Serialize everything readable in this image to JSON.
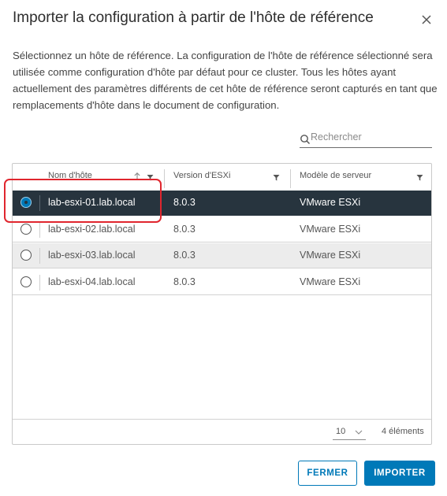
{
  "dialog": {
    "title": "Importer la configuration à partir de l'hôte de référence",
    "description": "Sélectionnez un hôte de référence. La configuration de l'hôte de référence sélectionné sera utilisée comme configuration d'hôte par défaut pour ce cluster. Tous les hôtes ayant actuellement des paramètres différents de cet hôte de référence seront capturés en tant que remplacements d'hôte dans le document de configuration."
  },
  "search": {
    "placeholder": "Rechercher",
    "icon": "search-icon"
  },
  "table": {
    "columns": [
      {
        "label": "Nom d'hôte",
        "sortable": true,
        "filterable": true
      },
      {
        "label": "Version d'ESXi",
        "filterable": true
      },
      {
        "label": "Modèle de serveur",
        "filterable": true
      }
    ],
    "rows": [
      {
        "host": "lab-esxi-01.lab.local",
        "version": "8.0.3",
        "model": "VMware ESXi",
        "selected": true
      },
      {
        "host": "lab-esxi-02.lab.local",
        "version": "8.0.3",
        "model": "VMware ESXi",
        "selected": false
      },
      {
        "host": "lab-esxi-03.lab.local",
        "version": "8.0.3",
        "model": "VMware ESXi",
        "selected": false
      },
      {
        "host": "lab-esxi-04.lab.local",
        "version": "8.0.3",
        "model": "VMware ESXi",
        "selected": false
      }
    ],
    "footer": {
      "page_size": "10",
      "item_count": "4 éléments"
    }
  },
  "buttons": {
    "cancel": "FERMER",
    "import": "IMPORTER"
  },
  "colors": {
    "accent": "#0079b8",
    "selected_row": "#27343e",
    "highlight": "#e0262e"
  }
}
